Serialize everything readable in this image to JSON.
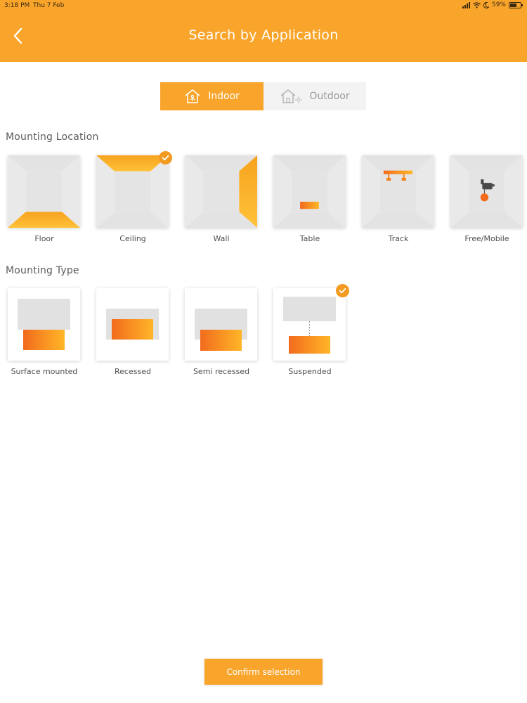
{
  "status_bar": {
    "time": "3:18 PM",
    "date": "Thu 7 Feb",
    "battery": "59%"
  },
  "header": {
    "title": "Search by Application"
  },
  "environment": {
    "options": [
      {
        "label": "Indoor",
        "icon": "indoor-house-icon",
        "selected": true
      },
      {
        "label": "Outdoor",
        "icon": "outdoor-house-icon",
        "selected": false
      }
    ]
  },
  "mounting_location": {
    "title": "Mounting Location",
    "items": [
      {
        "label": "Floor",
        "selected": false
      },
      {
        "label": "Ceiling",
        "selected": true
      },
      {
        "label": "Wall",
        "selected": false
      },
      {
        "label": "Table",
        "selected": false
      },
      {
        "label": "Track",
        "selected": false
      },
      {
        "label": "Free/Mobile",
        "selected": false
      }
    ]
  },
  "mounting_type": {
    "title": "Mounting Type",
    "items": [
      {
        "label": "Surface mounted",
        "selected": false
      },
      {
        "label": "Recessed",
        "selected": false
      },
      {
        "label": "Semi recessed",
        "selected": false
      },
      {
        "label": "Suspended",
        "selected": true
      }
    ]
  },
  "confirm_button": {
    "label": "Confirm selection"
  },
  "colors": {
    "accent": "#f9a52b",
    "accent_dark": "#f07f1a",
    "room_gray": "#e1e1e1"
  }
}
